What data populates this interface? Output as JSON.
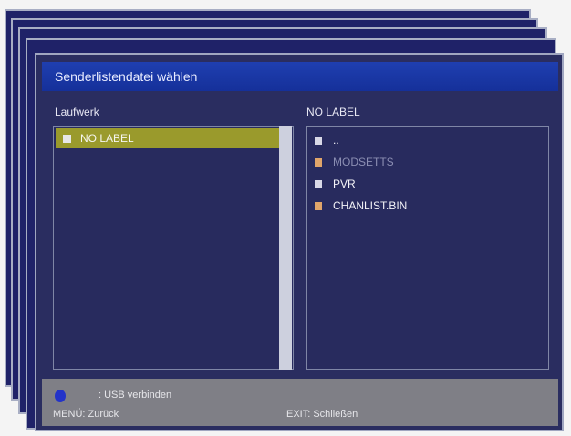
{
  "dialog": {
    "title": "Senderlistendatei wählen",
    "left_column_label": "Laufwerk",
    "right_column_label": "NO LABEL",
    "drive_list": [
      {
        "label": "NO LABEL",
        "selected": true
      }
    ],
    "file_list": [
      {
        "label": "..",
        "type": "folder",
        "dim": false
      },
      {
        "label": "MODSETTS",
        "type": "file",
        "dim": true
      },
      {
        "label": "PVR",
        "type": "folder",
        "dim": false
      },
      {
        "label": "CHANLIST.BIN",
        "type": "file",
        "dim": false
      }
    ],
    "footer": {
      "usb_label": ": USB verbinden",
      "menu_label": "MENÜ: Zurück",
      "exit_label": "EXIT: Schließen"
    }
  },
  "colors": {
    "window": "#2a2d60",
    "title": "#1f3fb0",
    "selection": "#9a9a2c",
    "footer": "#7f7f86",
    "blue_button": "#2333c9"
  }
}
